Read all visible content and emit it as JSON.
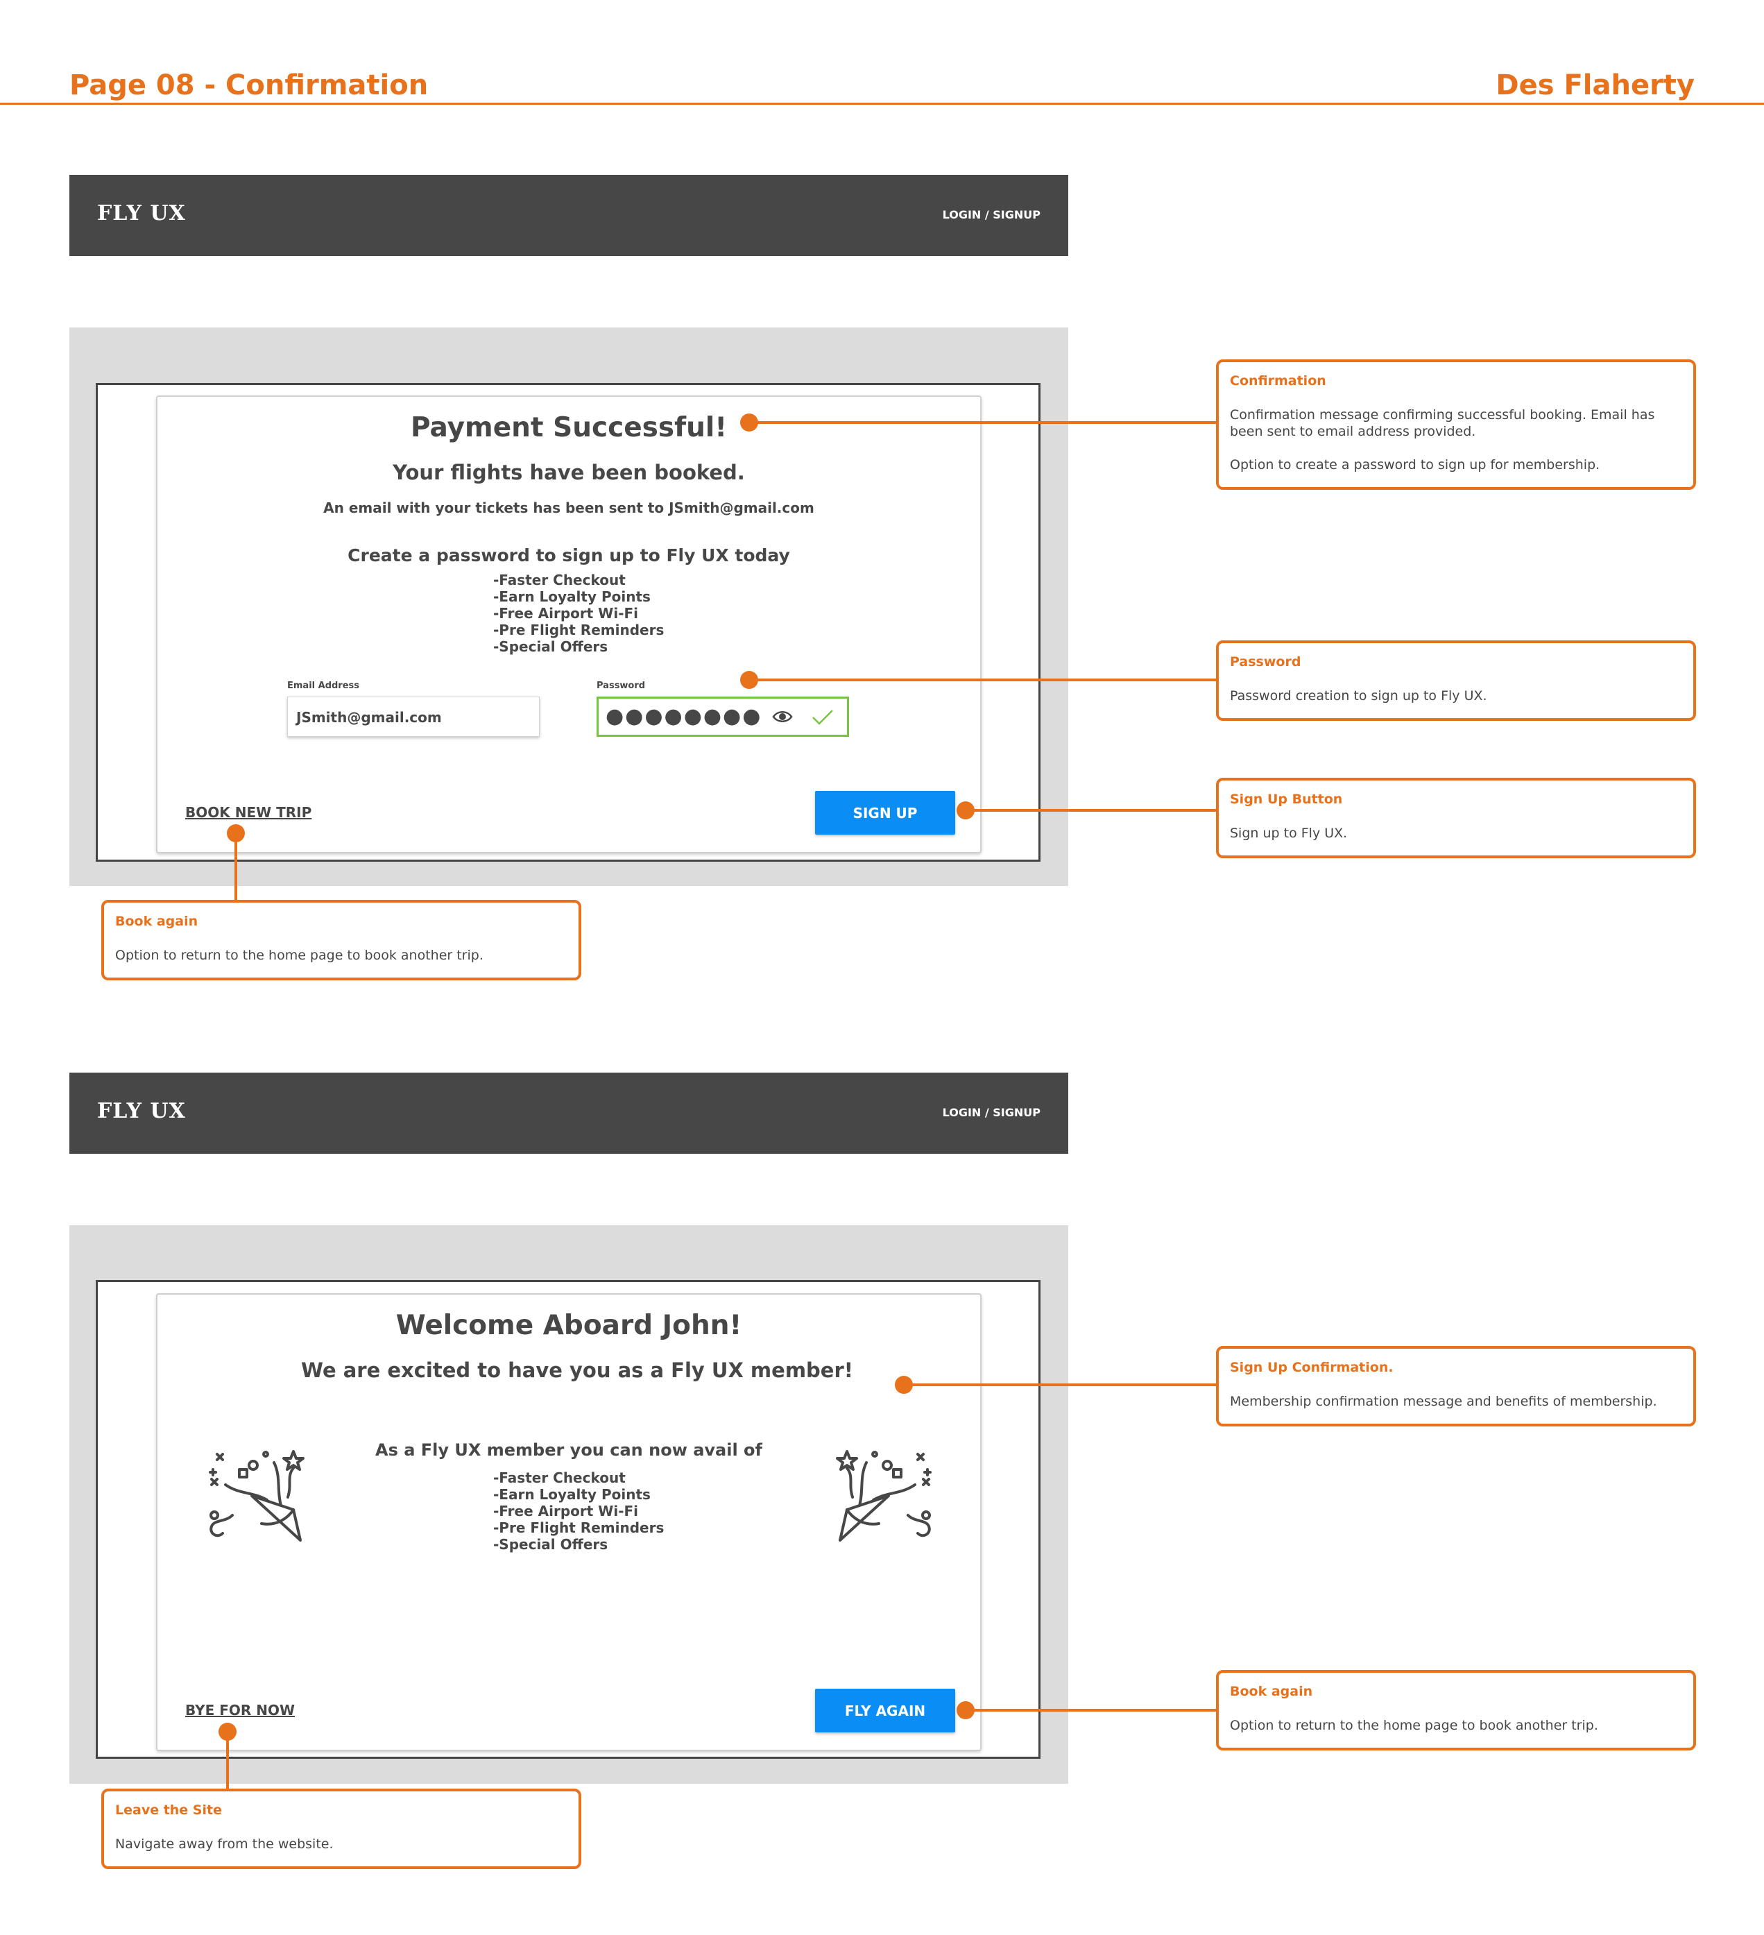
{
  "header": {
    "title": "Page 08 - Confirmation",
    "author": "Des Flaherty"
  },
  "nav": {
    "logo": "FLY UX",
    "login": "LOGIN / SIGNUP"
  },
  "screen1": {
    "heading": "Payment Successful!",
    "subheading": "Your flights have been booked.",
    "email_message": "An email with your tickets has been sent to JSmith@gmail.com",
    "signup_prompt": "Create a password to sign up to Fly UX today",
    "benefits": [
      "-Faster Checkout",
      "-Earn Loyalty Points",
      "-Free Airport Wi-Fi",
      "-Pre Flight Reminders",
      "-Special Offers"
    ],
    "email_label": "Email Address",
    "email_value": "JSmith@gmail.com",
    "password_label": "Password",
    "password_mask": "●●●●●●●●",
    "book_link": "BOOK NEW TRIP",
    "signup_button": "SIGN UP"
  },
  "screen2": {
    "heading": "Welcome Aboard John!",
    "subheading": "We are excited to have you as a Fly UX member!",
    "benefits_title": "As a Fly UX member you can now avail of",
    "benefits": [
      "-Faster Checkout",
      "-Earn Loyalty Points",
      "-Free Airport Wi-Fi",
      "-Pre Flight Reminders",
      "-Special Offers"
    ],
    "bye_link": "BYE FOR NOW",
    "fly_button": "FLY AGAIN"
  },
  "callouts": {
    "confirmation": {
      "title": "Confirmation",
      "body1": "Confirmation message confirming successful booking. Email has been sent to email address provided.",
      "body2": "Option to create a password to sign up for membership."
    },
    "password": {
      "title": "Password",
      "body": "Password creation to sign up to Fly UX."
    },
    "signup_button": {
      "title": "Sign Up Button",
      "body": "Sign up to Fly UX."
    },
    "book_again_1": {
      "title": "Book again",
      "body": "Option to return to the home page to book another trip."
    },
    "signup_confirmation": {
      "title": "Sign Up Confirmation.",
      "body": "Membership confirmation message and benefits of membership."
    },
    "book_again_2": {
      "title": "Book again",
      "body": "Option to return to the home page to book another trip."
    },
    "leave_site": {
      "title": "Leave the Site",
      "body": "Navigate away from the website."
    }
  },
  "colors": {
    "accent": "#e8711c",
    "nav": "#474747",
    "button": "#0a8ef6",
    "valid": "#76c442",
    "backdrop": "#dcdcdc"
  }
}
